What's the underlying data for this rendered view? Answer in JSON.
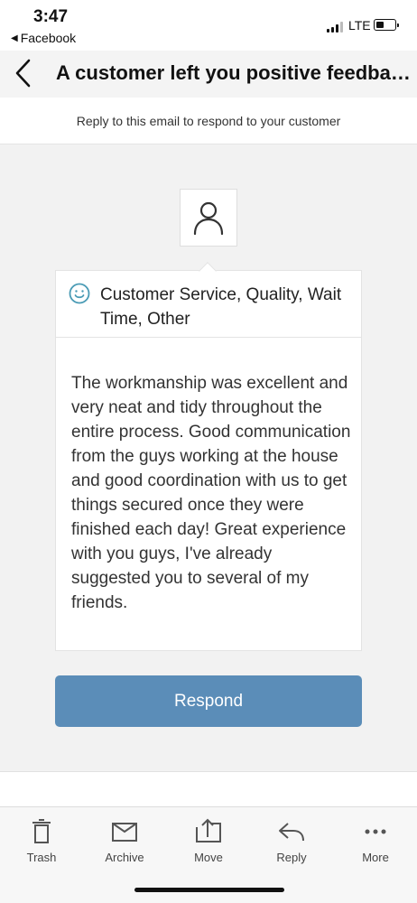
{
  "status_bar": {
    "time": "3:47",
    "back_app": "Facebook",
    "network": "LTE"
  },
  "nav": {
    "title": "A customer left you positive feedbac..."
  },
  "reply_hint": "Reply to this email to respond to your customer",
  "feedback": {
    "categories": "Customer Service, Quality, Wait Time, Other",
    "review": "The workmanship was excellent and very neat and tidy throughout the entire process. Good communication from the guys working at the house and good coordination with us to get things secured once they were finished each day! Great experience with you guys, I've already suggested you to several of my friends.",
    "accent_color": "#4a9bb5"
  },
  "respond_button": {
    "label": "Respond",
    "color": "#5b8db8"
  },
  "toolbar": {
    "items": [
      {
        "label": "Trash",
        "icon": "trash-icon"
      },
      {
        "label": "Archive",
        "icon": "archive-icon"
      },
      {
        "label": "Move",
        "icon": "move-icon"
      },
      {
        "label": "Reply",
        "icon": "reply-icon"
      },
      {
        "label": "More",
        "icon": "more-icon"
      }
    ]
  }
}
